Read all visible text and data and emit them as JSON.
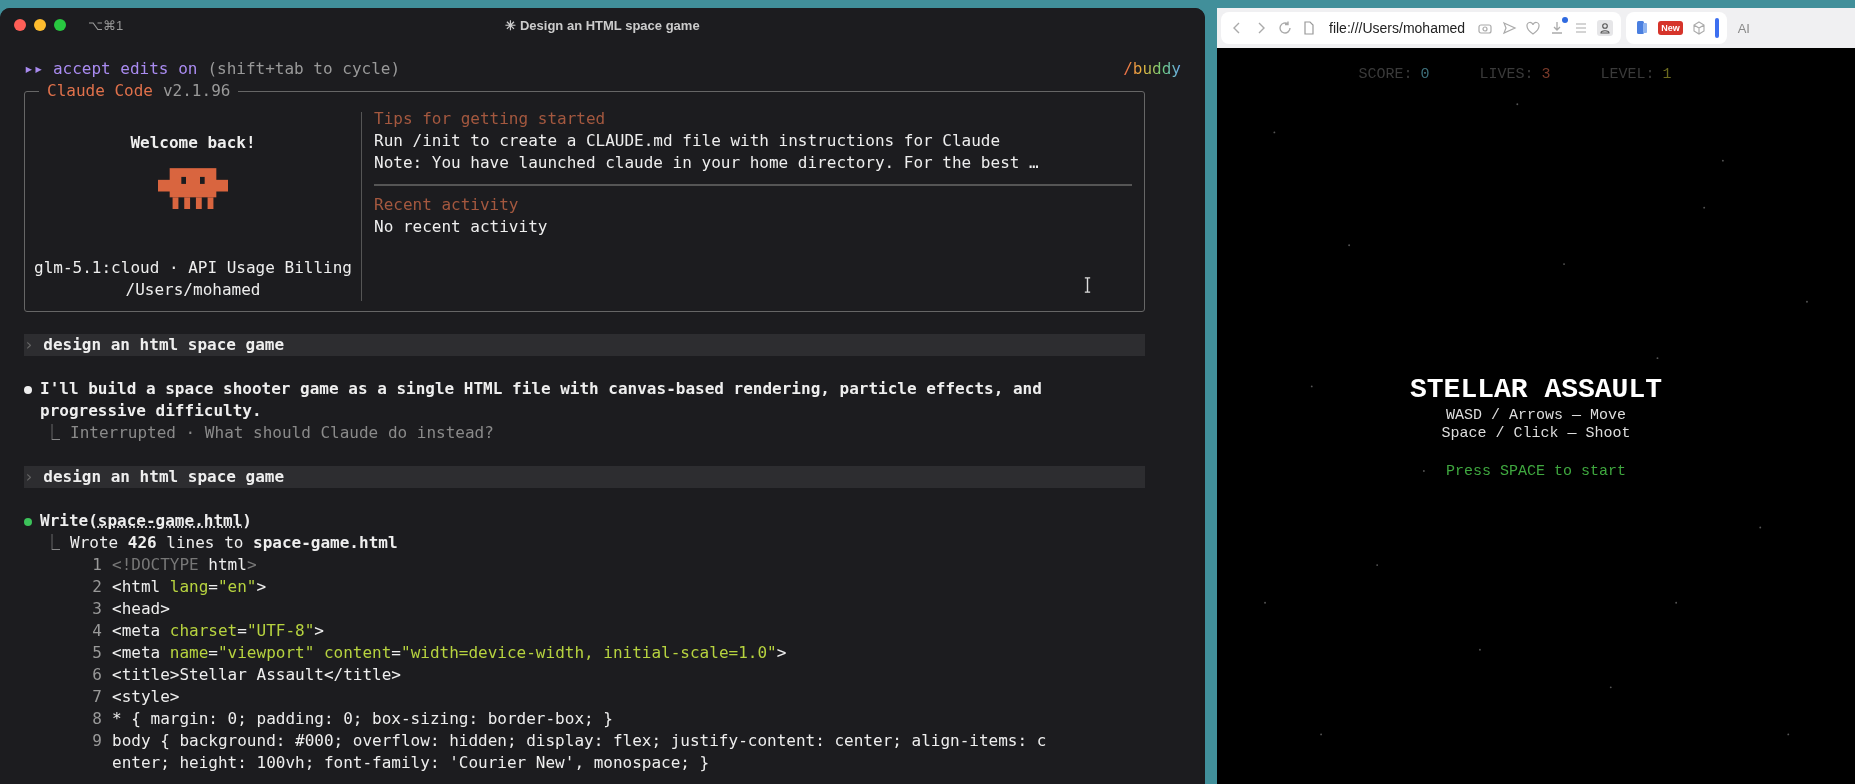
{
  "terminal": {
    "shortcut": "⌥⌘1",
    "title": "✳ Design an HTML space game",
    "mode": {
      "arrows": "▸▸",
      "label": "accept edits on",
      "hint": "(shift+tab to cycle)"
    },
    "buddy": "/buddy",
    "welcome_box": {
      "app_name": "Claude Code",
      "version": "v2.1.96",
      "greeting": "Welcome back!",
      "model_line": "glm-5.1:cloud · API Usage Billing",
      "path": "/Users/mohamed",
      "sections": [
        {
          "title": "Tips for getting started",
          "lines": [
            "Run /init to create a CLAUDE.md file with instructions for Claude",
            "Note: You have launched claude in your home directory. For the best …"
          ]
        },
        {
          "title": "Recent activity",
          "lines": [
            "No recent activity"
          ]
        }
      ]
    },
    "transcript": [
      {
        "kind": "prompt",
        "marker": "›",
        "text": "design an html space game"
      },
      {
        "kind": "message",
        "text": "I'll build a space shooter game as a single HTML file with canvas-based rendering, particle effects, and progressive difficulty.",
        "result_marker": "⎿",
        "result": "Interrupted · What should Claude do instead?"
      },
      {
        "kind": "prompt",
        "marker": "›",
        "text": "design an html space game"
      },
      {
        "kind": "tool",
        "tool": "Write",
        "open": "(",
        "argument": "space-game.html",
        "close": ")",
        "result_marker": "⎿",
        "result": "Wrote **426** lines to **space-game.html**",
        "code_lines": [
          {
            "number": "1",
            "segments": [
              {
                "text": "<!DOCTYPE",
                "kind": "dim"
              },
              {
                "text": " html",
                "kind": "text"
              },
              {
                "text": ">",
                "kind": "dim"
              }
            ]
          },
          {
            "number": "2",
            "segments": [
              {
                "text": "<html ",
                "kind": "text"
              },
              {
                "text": "lang",
                "kind": "attr"
              },
              {
                "text": "=",
                "kind": "text"
              },
              {
                "text": "\"en\"",
                "kind": "string"
              },
              {
                "text": ">",
                "kind": "text"
              }
            ]
          },
          {
            "number": "3",
            "segments": [
              {
                "text": "<head>",
                "kind": "text"
              }
            ]
          },
          {
            "number": "4",
            "segments": [
              {
                "text": "<meta ",
                "kind": "text"
              },
              {
                "text": "charset",
                "kind": "attr"
              },
              {
                "text": "=",
                "kind": "text"
              },
              {
                "text": "\"UTF-8\"",
                "kind": "string"
              },
              {
                "text": ">",
                "kind": "text"
              }
            ]
          },
          {
            "number": "5",
            "segments": [
              {
                "text": "<meta ",
                "kind": "text"
              },
              {
                "text": "name",
                "kind": "attr"
              },
              {
                "text": "=",
                "kind": "text"
              },
              {
                "text": "\"viewport\"",
                "kind": "string"
              },
              {
                "text": " content",
                "kind": "attr"
              },
              {
                "text": "=",
                "kind": "text"
              },
              {
                "text": "\"width=device-width, initial-scale=1.0\"",
                "kind": "string"
              },
              {
                "text": ">",
                "kind": "text"
              }
            ]
          },
          {
            "number": "6",
            "segments": [
              {
                "text": "<title>Stellar Assault</title>",
                "kind": "text"
              }
            ]
          },
          {
            "number": "7",
            "segments": [
              {
                "text": "<style>",
                "kind": "text"
              }
            ]
          },
          {
            "number": "8",
            "segments": [
              {
                "text": "* { margin: 0; padding: 0; box-sizing: border-box; }",
                "kind": "text"
              }
            ]
          },
          {
            "number": "9",
            "segments": [
              {
                "text": "body { background: #000; overflow: hidden; display: flex; justify-content: center; align-items: center; height: 100vh; font-family: 'Courier New', monospace; }",
                "kind": "text"
              }
            ]
          }
        ]
      }
    ],
    "cursor_visible": true
  },
  "browser": {
    "url": "file:///Users/mohamed",
    "downloads_badge": true,
    "new_badge": "New",
    "ai_label": "AI",
    "game": {
      "hud": [
        {
          "label": "SCORE:",
          "value": "0",
          "color": "#3d6f7a"
        },
        {
          "label": "LIVES:",
          "value": "3",
          "color": "#7a3a2a"
        },
        {
          "label": "LEVEL:",
          "value": "1",
          "color": "#6b6a1e"
        }
      ],
      "title": "STELLAR ASSAULT",
      "controls": [
        "WASD / Arrows — Move",
        "Space / Click — Shoot"
      ],
      "prompt": "Press SPACE to start"
    }
  }
}
